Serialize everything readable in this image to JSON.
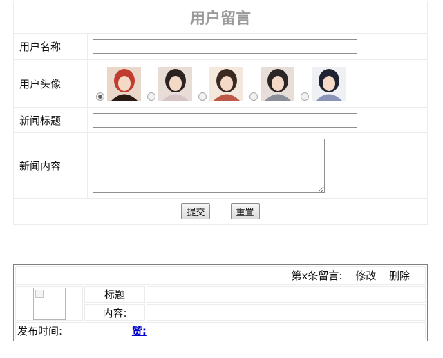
{
  "form": {
    "title": "用户留言",
    "username_label": "用户名称",
    "username_value": "",
    "avatar_label": "用户头像",
    "avatars": [
      {
        "name": "avatar-1",
        "selected": true,
        "colors": [
          "#e9d7c9",
          "#c23b2f",
          "#2a1a14"
        ]
      },
      {
        "name": "avatar-2",
        "selected": false,
        "colors": [
          "#e8dcd6",
          "#2b2322",
          "#d6c3c3"
        ]
      },
      {
        "name": "avatar-3",
        "selected": false,
        "colors": [
          "#f4e8dd",
          "#3a2a22",
          "#c05848"
        ]
      },
      {
        "name": "avatar-4",
        "selected": false,
        "colors": [
          "#e7ddd9",
          "#2c2525",
          "#8b8f98"
        ]
      },
      {
        "name": "avatar-5",
        "selected": false,
        "colors": [
          "#eef0f4",
          "#1f2230",
          "#8a93b8"
        ]
      }
    ],
    "news_title_label": "新闻标题",
    "news_title_value": "",
    "news_content_label": "新闻内容",
    "news_content_value": "",
    "submit_label": "提交",
    "reset_label": "重置"
  },
  "message": {
    "index_label": "第x条留言:",
    "edit_label": "修改",
    "delete_label": "删除",
    "title_label": "标题",
    "title_value": "",
    "content_label": "内容:",
    "content_value": "",
    "time_label": "发布时间:",
    "time_value": "",
    "like_label": "赞:"
  }
}
